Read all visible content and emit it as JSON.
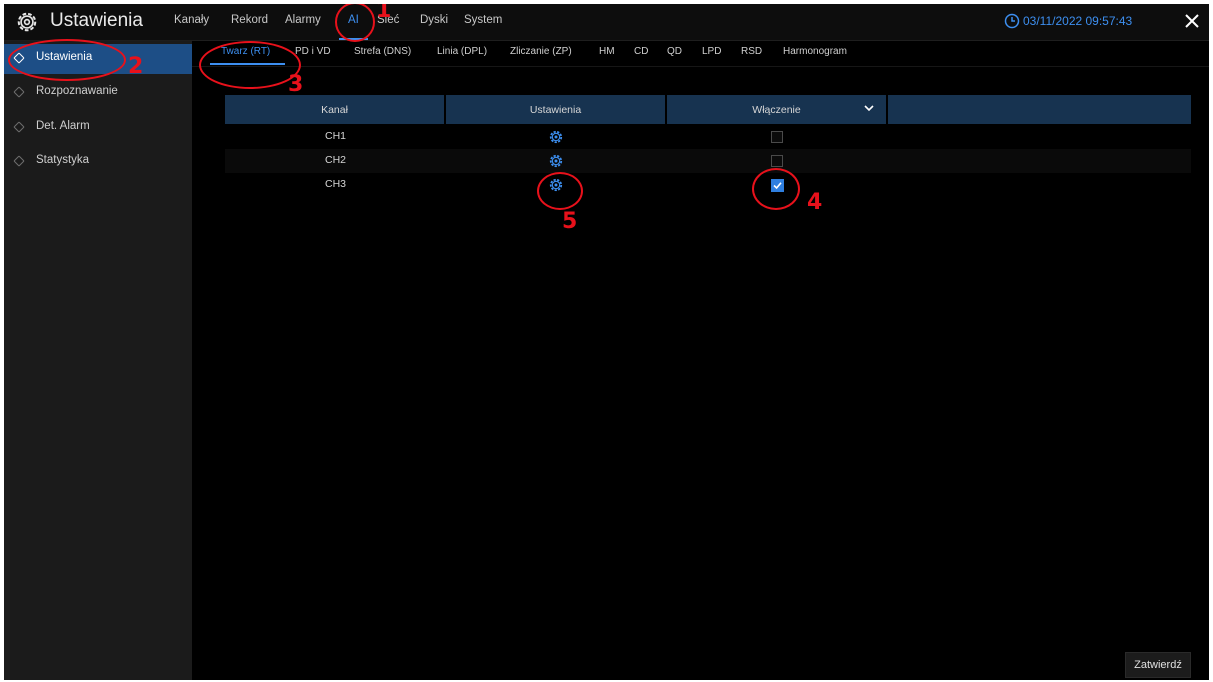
{
  "app": {
    "title": "Ustawienia",
    "icon": "gear-icon"
  },
  "main_tabs": [
    "Kanały",
    "Rekord",
    "Alarmy",
    "AI",
    "Sieć",
    "Dyski",
    "System"
  ],
  "main_tab_active": "AI",
  "datetime": "03/11/2022 09:57:43",
  "sidebar": {
    "items": [
      "Ustawienia",
      "Rozpoznawanie",
      "Det. Alarm",
      "Statystyka"
    ],
    "active": "Ustawienia"
  },
  "sub_tabs": [
    "Twarz (RT)",
    "PD i VD",
    "Strefa (DNS)",
    "Linia (DPL)",
    "Zliczanie (ZP)",
    "HM",
    "CD",
    "QD",
    "LPD",
    "RSD",
    "Harmonogram"
  ],
  "sub_tab_active": "Twarz (RT)",
  "table": {
    "headers": [
      "Kanał",
      "Ustawienia",
      "Włączenie",
      ""
    ],
    "rows": [
      {
        "channel": "CH1",
        "enabled": false
      },
      {
        "channel": "CH2",
        "enabled": false
      },
      {
        "channel": "CH3",
        "enabled": true
      }
    ]
  },
  "buttons": {
    "submit": "Zatwierdź"
  },
  "annotations": {
    "labels": [
      "1",
      "2",
      "3",
      "4",
      "5"
    ],
    "color": "#e8111b"
  },
  "colors": {
    "accent": "#3d8ff0",
    "sidebar_active": "#1d4e86",
    "header_bg": "#173350"
  }
}
